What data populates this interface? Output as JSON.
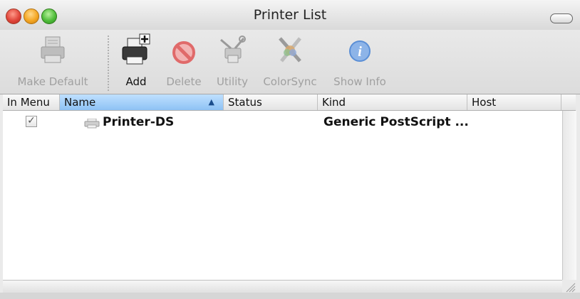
{
  "window": {
    "title": "Printer List"
  },
  "toolbar": {
    "make_default": {
      "label": "Make Default",
      "icon": "printer-icon",
      "enabled": false
    },
    "add": {
      "label": "Add",
      "icon": "add-printer-icon",
      "enabled": true
    },
    "delete": {
      "label": "Delete",
      "icon": "delete-icon",
      "enabled": false
    },
    "utility": {
      "label": "Utility",
      "icon": "utility-icon",
      "enabled": false
    },
    "colorsync": {
      "label": "ColorSync",
      "icon": "colorsync-icon",
      "enabled": false
    },
    "show_info": {
      "label": "Show Info",
      "icon": "info-icon",
      "enabled": false
    }
  },
  "table": {
    "columns": [
      "In Menu",
      "Name",
      "Status",
      "Kind",
      "Host"
    ],
    "sorted_column": "Name",
    "sort_direction": "ascending",
    "rows": [
      {
        "in_menu": true,
        "name": "Printer-DS",
        "status": "",
        "kind": "Generic PostScript ...",
        "host": ""
      }
    ]
  },
  "colors": {
    "sorted_header": "#8ec2f4",
    "close": "#e0453a",
    "minimize": "#f4a623",
    "zoom": "#4fbd3a",
    "info_blue": "#5b8fd6",
    "delete_red": "#e06a6a"
  }
}
